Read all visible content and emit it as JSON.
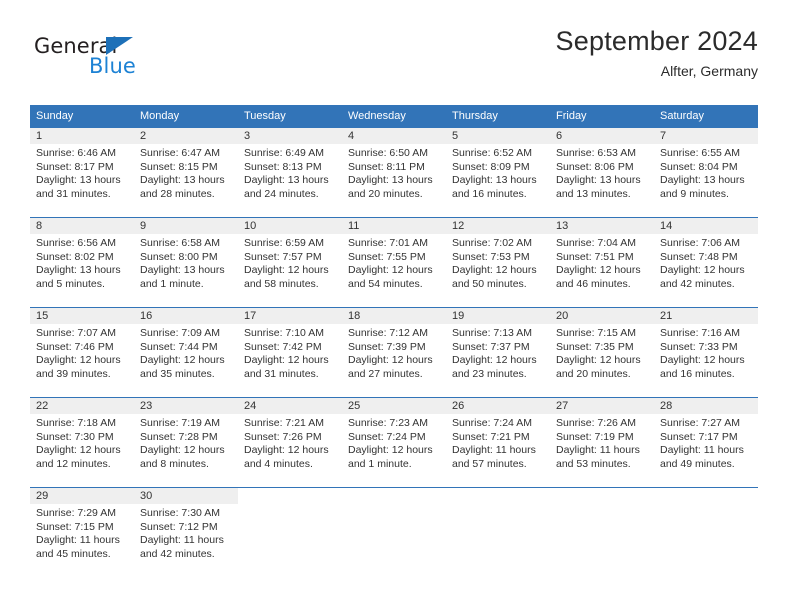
{
  "brand": {
    "name_part1": "General",
    "name_part2": "Blue",
    "primary_color": "#1d70b8",
    "secondary_color": "#1d82d4"
  },
  "header": {
    "title": "September 2024",
    "location": "Alfter, Germany"
  },
  "calendar": {
    "header_bg": "#3274b8",
    "daynum_bg": "#efefef",
    "weekday_headers": [
      "Sunday",
      "Monday",
      "Tuesday",
      "Wednesday",
      "Thursday",
      "Friday",
      "Saturday"
    ],
    "weeks": [
      [
        {
          "day": "1",
          "sunrise": "Sunrise: 6:46 AM",
          "sunset": "Sunset: 8:17 PM",
          "daylight_line1": "Daylight: 13 hours",
          "daylight_line2": "and 31 minutes."
        },
        {
          "day": "2",
          "sunrise": "Sunrise: 6:47 AM",
          "sunset": "Sunset: 8:15 PM",
          "daylight_line1": "Daylight: 13 hours",
          "daylight_line2": "and 28 minutes."
        },
        {
          "day": "3",
          "sunrise": "Sunrise: 6:49 AM",
          "sunset": "Sunset: 8:13 PM",
          "daylight_line1": "Daylight: 13 hours",
          "daylight_line2": "and 24 minutes."
        },
        {
          "day": "4",
          "sunrise": "Sunrise: 6:50 AM",
          "sunset": "Sunset: 8:11 PM",
          "daylight_line1": "Daylight: 13 hours",
          "daylight_line2": "and 20 minutes."
        },
        {
          "day": "5",
          "sunrise": "Sunrise: 6:52 AM",
          "sunset": "Sunset: 8:09 PM",
          "daylight_line1": "Daylight: 13 hours",
          "daylight_line2": "and 16 minutes."
        },
        {
          "day": "6",
          "sunrise": "Sunrise: 6:53 AM",
          "sunset": "Sunset: 8:06 PM",
          "daylight_line1": "Daylight: 13 hours",
          "daylight_line2": "and 13 minutes."
        },
        {
          "day": "7",
          "sunrise": "Sunrise: 6:55 AM",
          "sunset": "Sunset: 8:04 PM",
          "daylight_line1": "Daylight: 13 hours",
          "daylight_line2": "and 9 minutes."
        }
      ],
      [
        {
          "day": "8",
          "sunrise": "Sunrise: 6:56 AM",
          "sunset": "Sunset: 8:02 PM",
          "daylight_line1": "Daylight: 13 hours",
          "daylight_line2": "and 5 minutes."
        },
        {
          "day": "9",
          "sunrise": "Sunrise: 6:58 AM",
          "sunset": "Sunset: 8:00 PM",
          "daylight_line1": "Daylight: 13 hours",
          "daylight_line2": "and 1 minute."
        },
        {
          "day": "10",
          "sunrise": "Sunrise: 6:59 AM",
          "sunset": "Sunset: 7:57 PM",
          "daylight_line1": "Daylight: 12 hours",
          "daylight_line2": "and 58 minutes."
        },
        {
          "day": "11",
          "sunrise": "Sunrise: 7:01 AM",
          "sunset": "Sunset: 7:55 PM",
          "daylight_line1": "Daylight: 12 hours",
          "daylight_line2": "and 54 minutes."
        },
        {
          "day": "12",
          "sunrise": "Sunrise: 7:02 AM",
          "sunset": "Sunset: 7:53 PM",
          "daylight_line1": "Daylight: 12 hours",
          "daylight_line2": "and 50 minutes."
        },
        {
          "day": "13",
          "sunrise": "Sunrise: 7:04 AM",
          "sunset": "Sunset: 7:51 PM",
          "daylight_line1": "Daylight: 12 hours",
          "daylight_line2": "and 46 minutes."
        },
        {
          "day": "14",
          "sunrise": "Sunrise: 7:06 AM",
          "sunset": "Sunset: 7:48 PM",
          "daylight_line1": "Daylight: 12 hours",
          "daylight_line2": "and 42 minutes."
        }
      ],
      [
        {
          "day": "15",
          "sunrise": "Sunrise: 7:07 AM",
          "sunset": "Sunset: 7:46 PM",
          "daylight_line1": "Daylight: 12 hours",
          "daylight_line2": "and 39 minutes."
        },
        {
          "day": "16",
          "sunrise": "Sunrise: 7:09 AM",
          "sunset": "Sunset: 7:44 PM",
          "daylight_line1": "Daylight: 12 hours",
          "daylight_line2": "and 35 minutes."
        },
        {
          "day": "17",
          "sunrise": "Sunrise: 7:10 AM",
          "sunset": "Sunset: 7:42 PM",
          "daylight_line1": "Daylight: 12 hours",
          "daylight_line2": "and 31 minutes."
        },
        {
          "day": "18",
          "sunrise": "Sunrise: 7:12 AM",
          "sunset": "Sunset: 7:39 PM",
          "daylight_line1": "Daylight: 12 hours",
          "daylight_line2": "and 27 minutes."
        },
        {
          "day": "19",
          "sunrise": "Sunrise: 7:13 AM",
          "sunset": "Sunset: 7:37 PM",
          "daylight_line1": "Daylight: 12 hours",
          "daylight_line2": "and 23 minutes."
        },
        {
          "day": "20",
          "sunrise": "Sunrise: 7:15 AM",
          "sunset": "Sunset: 7:35 PM",
          "daylight_line1": "Daylight: 12 hours",
          "daylight_line2": "and 20 minutes."
        },
        {
          "day": "21",
          "sunrise": "Sunrise: 7:16 AM",
          "sunset": "Sunset: 7:33 PM",
          "daylight_line1": "Daylight: 12 hours",
          "daylight_line2": "and 16 minutes."
        }
      ],
      [
        {
          "day": "22",
          "sunrise": "Sunrise: 7:18 AM",
          "sunset": "Sunset: 7:30 PM",
          "daylight_line1": "Daylight: 12 hours",
          "daylight_line2": "and 12 minutes."
        },
        {
          "day": "23",
          "sunrise": "Sunrise: 7:19 AM",
          "sunset": "Sunset: 7:28 PM",
          "daylight_line1": "Daylight: 12 hours",
          "daylight_line2": "and 8 minutes."
        },
        {
          "day": "24",
          "sunrise": "Sunrise: 7:21 AM",
          "sunset": "Sunset: 7:26 PM",
          "daylight_line1": "Daylight: 12 hours",
          "daylight_line2": "and 4 minutes."
        },
        {
          "day": "25",
          "sunrise": "Sunrise: 7:23 AM",
          "sunset": "Sunset: 7:24 PM",
          "daylight_line1": "Daylight: 12 hours",
          "daylight_line2": "and 1 minute."
        },
        {
          "day": "26",
          "sunrise": "Sunrise: 7:24 AM",
          "sunset": "Sunset: 7:21 PM",
          "daylight_line1": "Daylight: 11 hours",
          "daylight_line2": "and 57 minutes."
        },
        {
          "day": "27",
          "sunrise": "Sunrise: 7:26 AM",
          "sunset": "Sunset: 7:19 PM",
          "daylight_line1": "Daylight: 11 hours",
          "daylight_line2": "and 53 minutes."
        },
        {
          "day": "28",
          "sunrise": "Sunrise: 7:27 AM",
          "sunset": "Sunset: 7:17 PM",
          "daylight_line1": "Daylight: 11 hours",
          "daylight_line2": "and 49 minutes."
        }
      ],
      [
        {
          "day": "29",
          "sunrise": "Sunrise: 7:29 AM",
          "sunset": "Sunset: 7:15 PM",
          "daylight_line1": "Daylight: 11 hours",
          "daylight_line2": "and 45 minutes."
        },
        {
          "day": "30",
          "sunrise": "Sunrise: 7:30 AM",
          "sunset": "Sunset: 7:12 PM",
          "daylight_line1": "Daylight: 11 hours",
          "daylight_line2": "and 42 minutes."
        },
        {
          "day": "",
          "sunrise": "",
          "sunset": "",
          "daylight_line1": "",
          "daylight_line2": ""
        },
        {
          "day": "",
          "sunrise": "",
          "sunset": "",
          "daylight_line1": "",
          "daylight_line2": ""
        },
        {
          "day": "",
          "sunrise": "",
          "sunset": "",
          "daylight_line1": "",
          "daylight_line2": ""
        },
        {
          "day": "",
          "sunrise": "",
          "sunset": "",
          "daylight_line1": "",
          "daylight_line2": ""
        },
        {
          "day": "",
          "sunrise": "",
          "sunset": "",
          "daylight_line1": "",
          "daylight_line2": ""
        }
      ]
    ]
  }
}
